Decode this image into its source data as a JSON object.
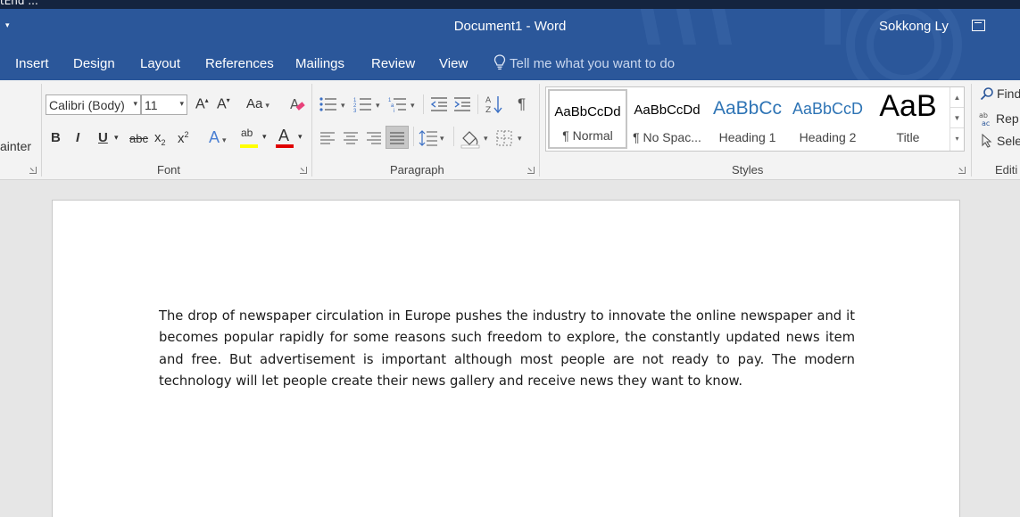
{
  "top_strip": {
    "fragment": "tEnd ..."
  },
  "titlebar": {
    "document_title": "Document1  -  Word",
    "user": "Sokkong Ly"
  },
  "tabs": [
    "Insert",
    "Design",
    "Layout",
    "References",
    "Mailings",
    "Review",
    "View"
  ],
  "tell_me": {
    "placeholder": "Tell me what you want to do",
    "icon": "lightbulb-icon"
  },
  "clipboard": {
    "format_painter_fragment": "ainter"
  },
  "font_group": {
    "label": "Font",
    "font_name": "Calibri (Body)",
    "font_size": "11",
    "grow": "A",
    "shrink": "A",
    "change_case": "Aa",
    "bold": "B",
    "italic": "I",
    "underline": "U",
    "strikethrough": "abc",
    "subscript": "x",
    "subscript_mark": "2",
    "superscript": "x",
    "superscript_mark": "2",
    "text_effects": "A",
    "highlight": "ab",
    "font_color": "A",
    "highlight_color": "#ffff00",
    "font_color_value": "#e00000"
  },
  "paragraph_group": {
    "label": "Paragraph",
    "sort_icon": "sort-az-icon",
    "pilcrow": "¶"
  },
  "styles_group": {
    "label": "Styles",
    "items": [
      {
        "preview": "AaBbCcDd",
        "name": "¶ Normal"
      },
      {
        "preview": "AaBbCcDd",
        "name": "¶ No Spac..."
      },
      {
        "preview": "AaBbCc",
        "name": "Heading 1"
      },
      {
        "preview": "AaBbCcD",
        "name": "Heading 2"
      },
      {
        "preview": "AaB",
        "name": "Title"
      }
    ]
  },
  "editing_group": {
    "label": "Editi",
    "find": "Find",
    "replace": "Rep",
    "select": "Sele"
  },
  "document": {
    "text": "The drop of newspaper circulation in Europe pushes the industry to innovate the online newspaper and it becomes popular rapidly for some reasons such freedom to explore, the constantly updated news item and free. But advertisement is important although most people are not ready to pay. The modern technology will let people create their news gallery and receive news they want to know."
  },
  "colors": {
    "word_blue": "#2b579a",
    "ribbon_bg": "#f3f3f3",
    "canvas_bg": "#e6e6e6"
  }
}
